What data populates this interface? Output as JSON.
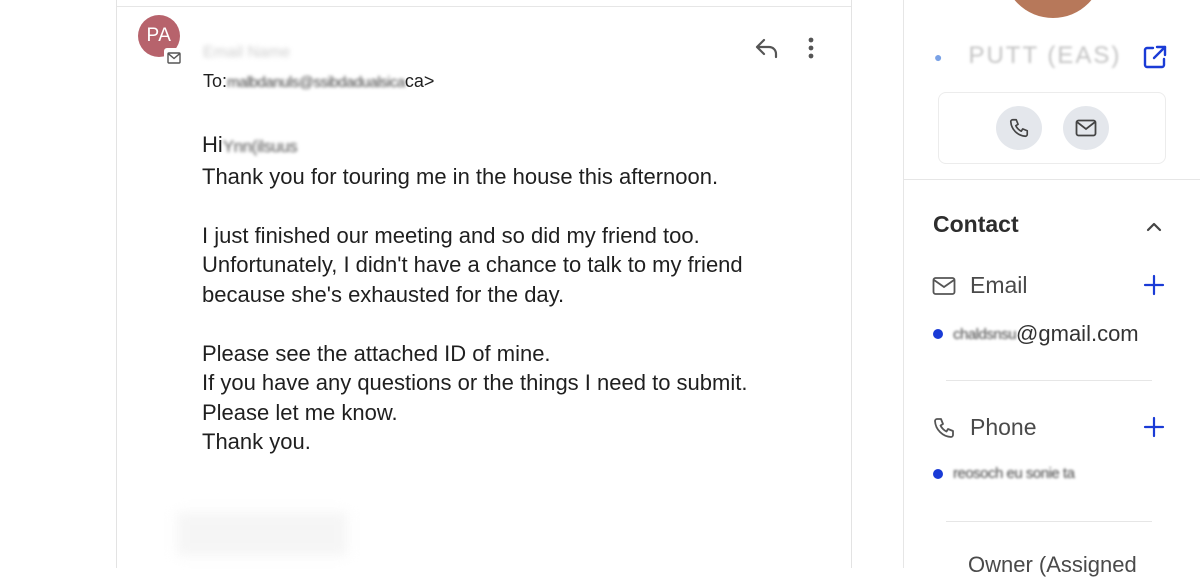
{
  "email": {
    "avatar_initials": "PA",
    "sender_name": "Email Name",
    "to_prefix": "To:",
    "to_redacted": "malbdanuls@ssibdadualsica",
    "to_suffix": "ca>",
    "greeting": "Hi",
    "greeting_name_redacted": "Ynn(ilsuus",
    "body_lines": [
      "Thank you for touring me in the house this afternoon.",
      "",
      "I just finished our meeting and so did my friend too.",
      "Unfortunately, I didn't have a chance to talk to my friend",
      "because she's exhausted for the day.",
      "",
      "Please see the attached ID of mine.",
      "If you have any questions or the things I need to submit.",
      "Please let me know.",
      "Thank you."
    ]
  },
  "contact_panel": {
    "name_redacted": "PUTT (EAS)",
    "section_title": "Contact",
    "email_label": "Email",
    "email_value_redacted": "chaldsnsu",
    "email_value_domain": "@gmail.com",
    "phone_label": "Phone",
    "phone_value_redacted": "reosoch eu sonie ta",
    "owner_label": "Owner (Assigned"
  },
  "colors": {
    "avatar_bg": "#b7636c",
    "accent_blue": "#1a3bd6",
    "action_circle_bg": "#e4e7ec"
  },
  "icons": [
    "mail-icon",
    "reply-icon",
    "more-vert-icon",
    "open-external-icon",
    "phone-icon",
    "chevron-up-icon",
    "plus-icon"
  ]
}
